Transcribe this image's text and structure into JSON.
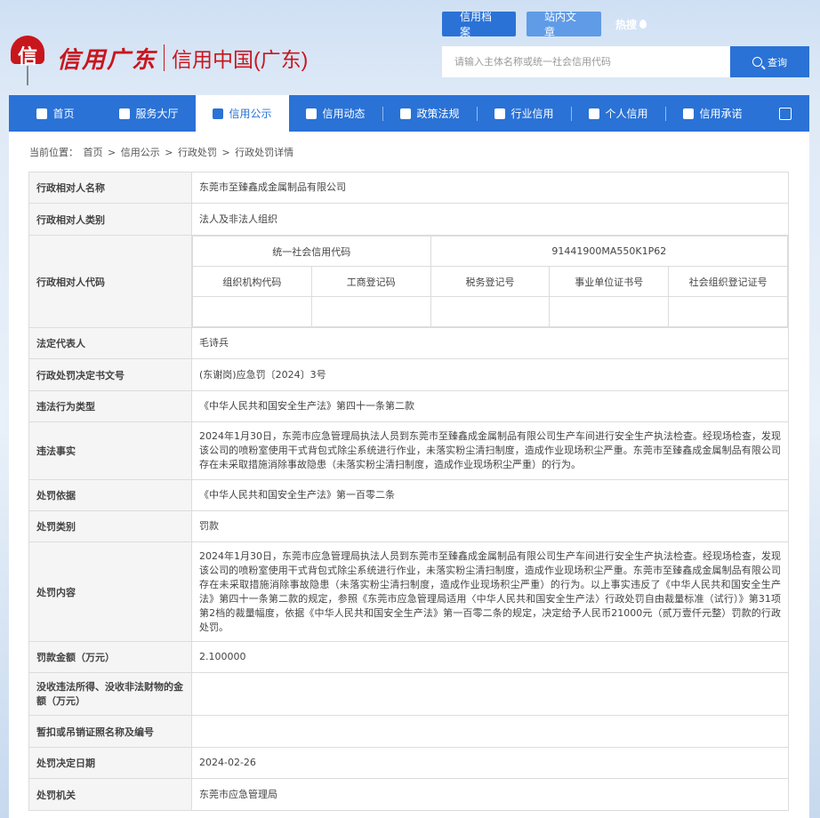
{
  "colors": {
    "brand_red": "#c8161d",
    "primary_blue": "#2a72d6"
  },
  "logo": {
    "mark_letter": "信",
    "title1": "信用广东",
    "title2": "信用中国(广东)"
  },
  "header_tabs": [
    {
      "label": "信用档案",
      "icon": ""
    },
    {
      "label": "站内文章",
      "icon": ""
    },
    {
      "label": "热搜",
      "icon": "flame-icon"
    }
  ],
  "search": {
    "placeholder": "请输入主体名称或统一社会信用代码",
    "button_label": "查询",
    "icon": "search-icon"
  },
  "nav": [
    {
      "label": "首页",
      "icon": "home-icon"
    },
    {
      "label": "服务大厅",
      "icon": "grid-icon"
    },
    {
      "label": "信用公示",
      "icon": "briefcase-icon"
    },
    {
      "label": "信用动态",
      "icon": "news-icon"
    },
    {
      "label": "政策法规",
      "icon": "book-icon"
    },
    {
      "label": "行业信用",
      "icon": "building-icon"
    },
    {
      "label": "个人信用",
      "icon": "id-card-icon"
    },
    {
      "label": "信用承诺",
      "icon": "shield-icon"
    }
  ],
  "breadcrumb": {
    "prefix": "当前位置：",
    "items": [
      "首页",
      "信用公示",
      "行政处罚",
      "行政处罚详情"
    ],
    "separator": ">"
  },
  "record": {
    "name_label": "行政相对人名称",
    "name": "东莞市至臻鑫成金属制品有限公司",
    "type_label": "行政相对人类别",
    "type": "法人及非法人组织",
    "code_label": "行政相对人代码",
    "uscc_label": "统一社会信用代码",
    "uscc": "91441900MA550K1P62",
    "org_code_label": "组织机构代码",
    "org_code": "",
    "biz_reg_label": "工商登记码",
    "biz_reg": "",
    "tax_reg_label": "税务登记号",
    "tax_reg": "",
    "inst_cert_label": "事业单位证书号",
    "inst_cert": "",
    "social_org_label": "社会组织登记证号",
    "social_org": "",
    "legal_rep_label": "法定代表人",
    "legal_rep": "毛诗兵",
    "doc_no_label": "行政处罚决定书文号",
    "doc_no": "(东谢岗)应急罚〔2024〕3号",
    "violation_type_label": "违法行为类型",
    "violation_type": "《中华人民共和国安全生产法》第四十一条第二款",
    "facts_label": "违法事实",
    "facts": "2024年1月30日，东莞市应急管理局执法人员到东莞市至臻鑫成金属制品有限公司生产车间进行安全生产执法检查。经现场检查，发现该公司的喷粉室使用干式背包式除尘系统进行作业，未落实粉尘清扫制度，造成作业现场积尘严重。东莞市至臻鑫成金属制品有限公司存在未采取措施消除事故隐患（未落实粉尘清扫制度，造成作业现场积尘严重）的行为。",
    "basis_label": "处罚依据",
    "basis": "《中华人民共和国安全生产法》第一百零二条",
    "category_label": "处罚类别",
    "category": "罚款",
    "content_label": "处罚内容",
    "content": "2024年1月30日，东莞市应急管理局执法人员到东莞市至臻鑫成金属制品有限公司生产车间进行安全生产执法检查。经现场检查，发现该公司的喷粉室使用干式背包式除尘系统进行作业，未落实粉尘清扫制度，造成作业现场积尘严重。东莞市至臻鑫成金属制品有限公司存在未采取措施消除事故隐患（未落实粉尘清扫制度，造成作业现场积尘严重）的行为。以上事实违反了《中华人民共和国安全生产法》第四十一条第二款的规定，参照《东莞市应急管理局适用〈中华人民共和国安全生产法〉行政处罚自由裁量标准（试行）》第31项第2档的裁量幅度，依据《中华人民共和国安全生产法》第一百零二条的规定，决定给予人民币21000元（贰万壹仟元整）罚款的行政处罚。",
    "fine_label": "罚款金额（万元）",
    "fine": "2.100000",
    "confiscation_label": "没收违法所得、没收非法财物的金额（万元）",
    "confiscation": "",
    "license_label": "暂扣或吊销证照名称及编号",
    "license": "",
    "decision_date_label": "处罚决定日期",
    "decision_date": "2024-02-26",
    "authority_label": "处罚机关",
    "authority": "东莞市应急管理局"
  }
}
